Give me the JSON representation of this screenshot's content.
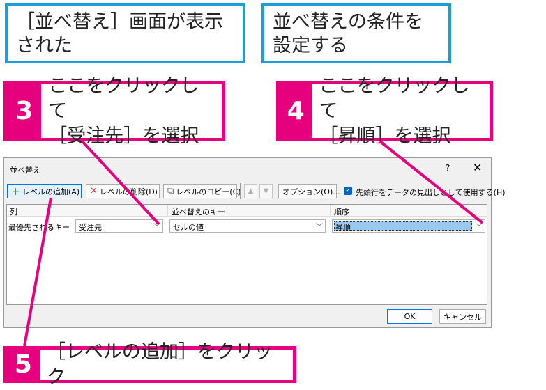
{
  "notes": {
    "screen_shown": [
      "［並べ替え］画面が表示",
      "された"
    ],
    "set_conditions": [
      "並べ替えの条件を",
      "設定する"
    ]
  },
  "steps": {
    "step3": {
      "num": "3",
      "lines": [
        "ここをクリックして",
        "［受注先］を選択"
      ]
    },
    "step4": {
      "num": "4",
      "lines": [
        "ここをクリックして",
        "［昇順］を選択"
      ]
    },
    "step5": {
      "num": "5",
      "lines": [
        "［レベルの追加］をクリック"
      ]
    }
  },
  "dialog": {
    "title": "並べ替え",
    "help": "?",
    "close": "✕",
    "toolbar": {
      "add_level": "レベルの追加(A)",
      "delete_level": "レベルの削除(D)",
      "copy_level": "レベルのコピー(C)",
      "options": "オプション(O)...",
      "header_checkbox": "先頭行をデータの見出しとして使用する(H)"
    },
    "columns": {
      "col": "列",
      "sort_on": "並べ替えのキー",
      "order": "順序"
    },
    "row": {
      "label": "最優先されるキー",
      "column_value": "受注先",
      "sort_on_value": "セルの値",
      "order_value": "昇順"
    },
    "ok": "OK",
    "cancel": "キャンセル"
  },
  "colors": {
    "accent_pink": "#e6007e",
    "accent_blue": "#1a9fdb",
    "selection": "#99c9ef"
  },
  "icons": [
    "plus-icon",
    "delete-x-icon",
    "copy-icon",
    "arrow-up-icon",
    "arrow-down-icon",
    "checkbox-checked-icon",
    "chevron-down-icon",
    "close-icon"
  ]
}
